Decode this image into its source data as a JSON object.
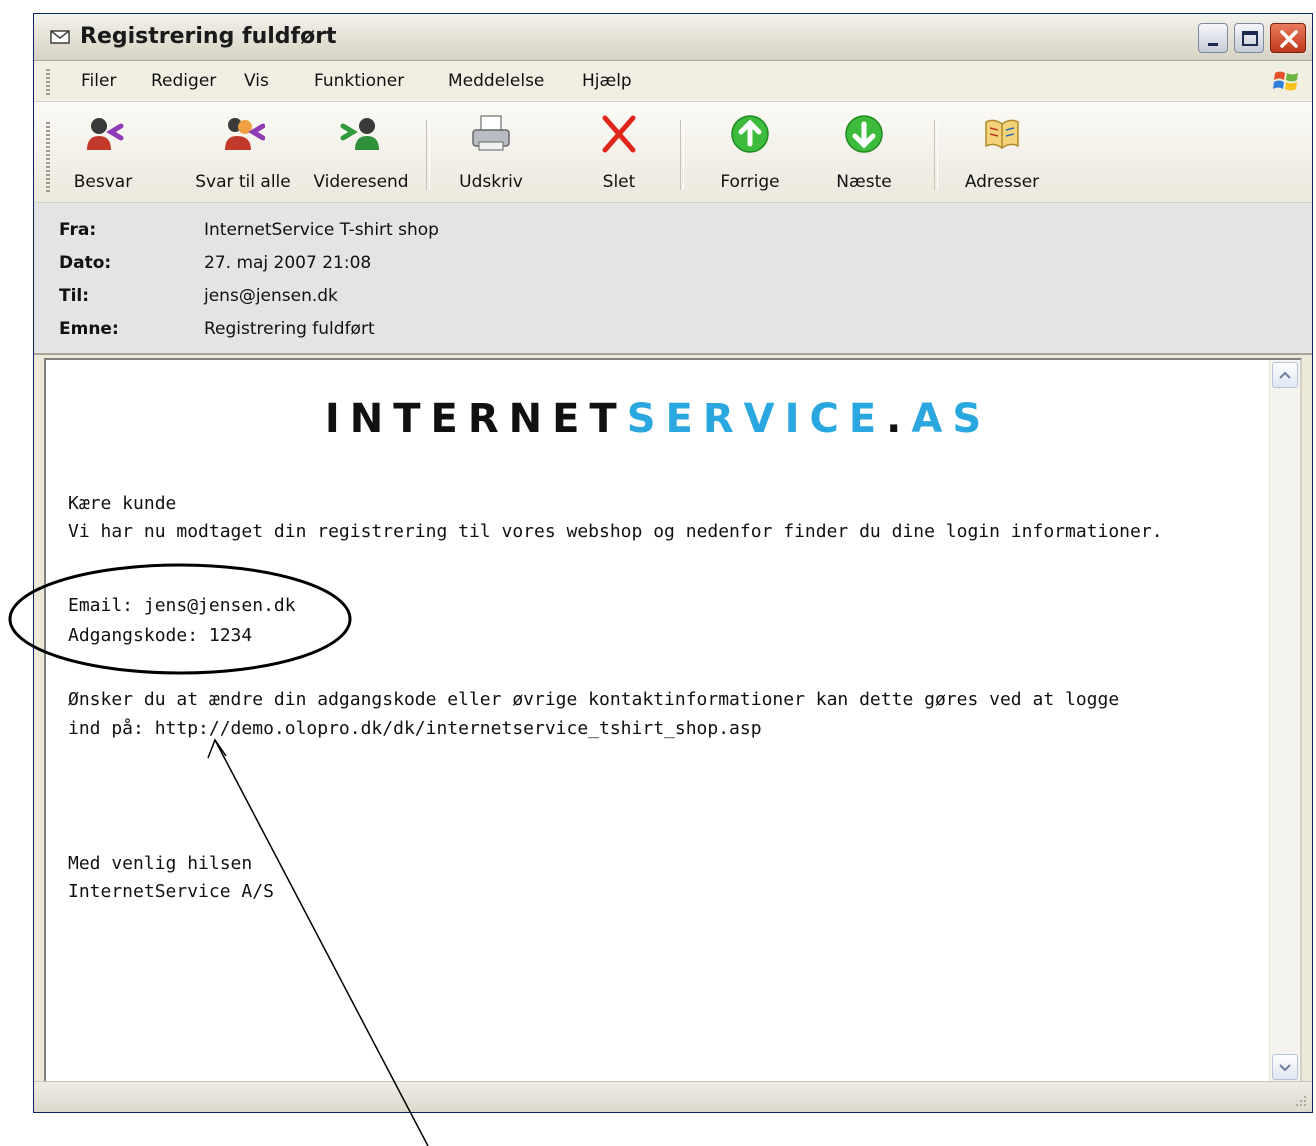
{
  "window": {
    "title": "Registrering fuldført"
  },
  "menu": {
    "items": [
      "Filer",
      "Rediger",
      "Vis",
      "Funktioner",
      "Meddelelse",
      "Hjælp"
    ]
  },
  "toolbar": {
    "reply": "Besvar",
    "reply_all": "Svar til alle",
    "forward": "Videresend",
    "print": "Udskriv",
    "delete": "Slet",
    "previous": "Forrige",
    "next": "Næste",
    "addresses": "Adresser"
  },
  "headers": {
    "from_label": "Fra:",
    "from_value": "InternetService T-shirt shop",
    "date_label": "Dato:",
    "date_value": "27. maj 2007 21:08",
    "to_label": "Til:",
    "to_value": "jens@jensen.dk",
    "subject_label": "Emne:",
    "subject_value": "Registrering fuldført"
  },
  "message": {
    "logo_part1": "INTERNET",
    "logo_part2": "SERVICE",
    "logo_dot": ".",
    "logo_part3": "AS",
    "greeting": "Kære kunde",
    "intro": "Vi har nu modtaget din registrering til vores webshop og nedenfor finder du dine login informationer.",
    "email_line": "Email: jens@jensen.dk",
    "password_line": "Adgangskode: 1234",
    "change_line1": "Ønsker du at ændre din adgangskode eller øvrige kontaktinformationer kan dette gøres ved at logge",
    "change_line2": "ind på: http://demo.olopro.dk/dk/internetservice_tshirt_shop.asp",
    "closing": "Med venlig hilsen",
    "signature": "InternetService A/S"
  },
  "colors": {
    "logo_blue": "#2aa7df",
    "window_bg": "#ece9d8",
    "close_button": "#c0391b"
  },
  "icons": [
    "envelope-icon",
    "reply-icon",
    "reply-all-icon",
    "forward-icon",
    "printer-icon",
    "delete-icon",
    "previous-icon",
    "next-icon",
    "address-book-icon",
    "windows-logo-icon"
  ]
}
